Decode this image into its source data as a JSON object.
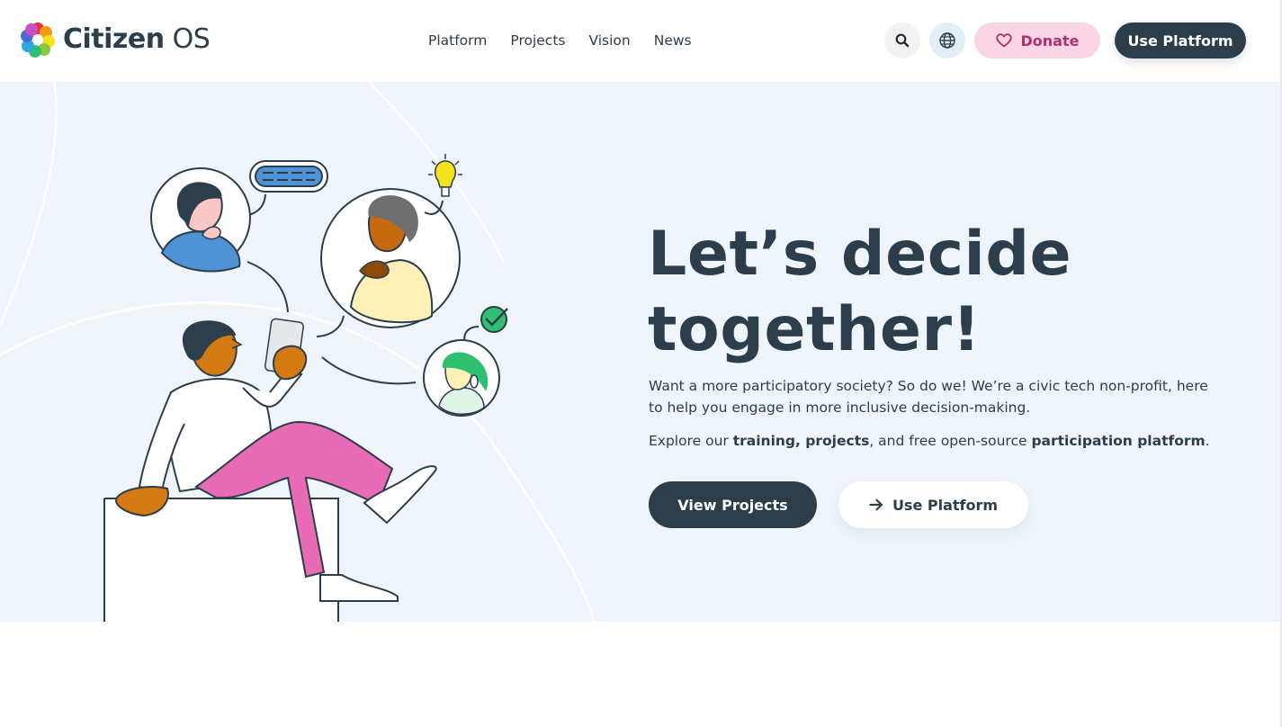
{
  "brand": {
    "name_bold": "Citizen",
    "name_light": "OS"
  },
  "nav": {
    "items": [
      {
        "label": "Platform"
      },
      {
        "label": "Projects"
      },
      {
        "label": "Vision"
      },
      {
        "label": "News"
      }
    ]
  },
  "header_actions": {
    "search_icon": "search-icon",
    "language_icon": "globe-icon",
    "donate_label": "Donate",
    "use_platform_label": "Use Platform"
  },
  "hero": {
    "headline_line1": "Let’s decide",
    "headline_line2": "together!",
    "intro": "Want a more participatory society? So do we! We’re a civic tech non-profit, here to help you engage in more inclusive decision-making.",
    "explore_prefix": "Explore our ",
    "explore_bold1": "training, projects",
    "explore_middle": ", and free open-source ",
    "explore_bold2": "participation platform",
    "explore_suffix": ".",
    "view_projects_label": "View Projects",
    "use_platform_label": "Use Platform"
  },
  "colors": {
    "primary": "#2c3e4c",
    "donate_bg": "#f9d5e5",
    "donate_text": "#b0306a",
    "hero_bg": "#eff5fb",
    "accent_pink": "#e86bb5",
    "accent_blue": "#4f93d6",
    "accent_green": "#2fbf71",
    "accent_yellow": "#f3e21c"
  }
}
